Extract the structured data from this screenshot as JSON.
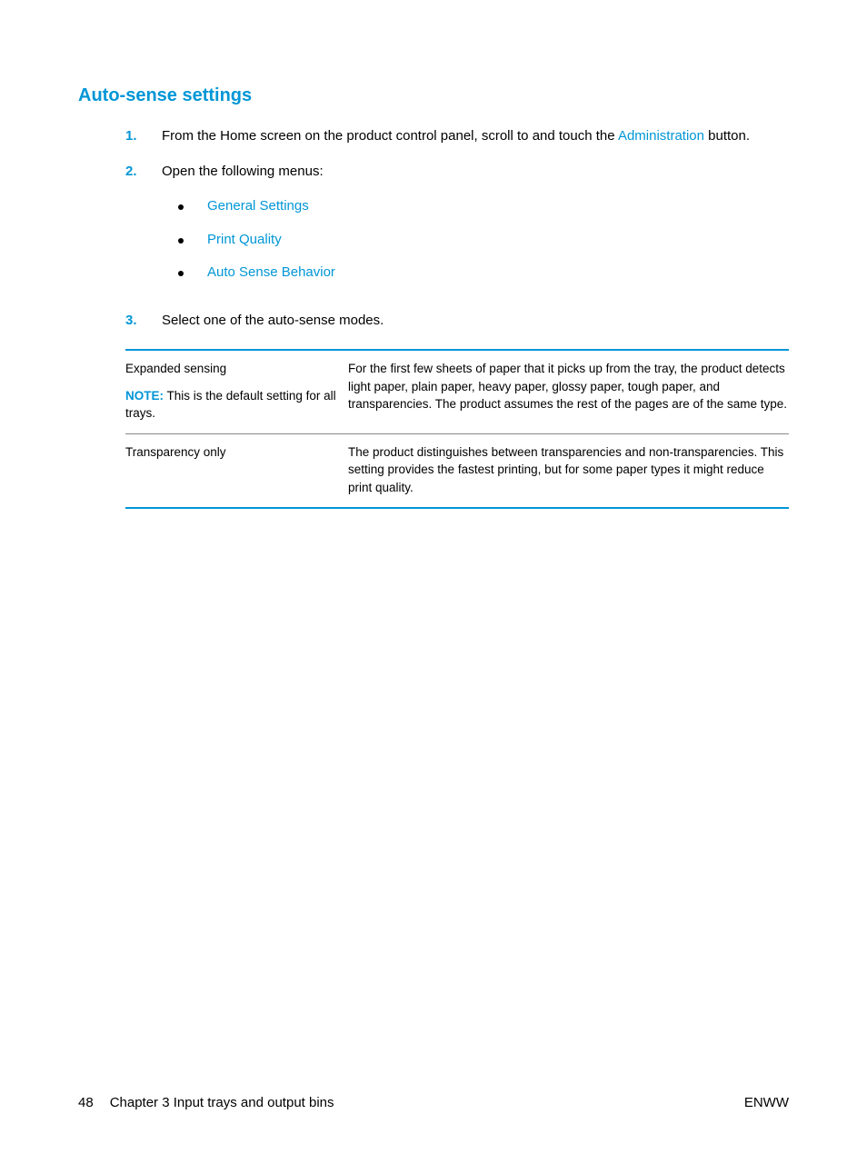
{
  "heading": "Auto-sense settings",
  "steps": [
    {
      "num": "1.",
      "pre": "From the Home screen on the product control panel, scroll to and touch the ",
      "term": "Administration",
      "post": " button."
    },
    {
      "num": "2.",
      "pre": "Open the following menus:",
      "bullets": [
        "General Settings",
        "Print Quality",
        "Auto Sense Behavior"
      ]
    },
    {
      "num": "3.",
      "pre": "Select one of the auto-sense modes."
    }
  ],
  "table": [
    {
      "mode": "Expanded sensing",
      "note_label": "NOTE:",
      "note_text": "This is the default setting for all trays.",
      "desc": "For the first few sheets of paper that it picks up from the tray, the product detects light paper, plain paper, heavy paper, glossy paper, tough paper, and transparencies. The product assumes the rest of the pages are of the same type."
    },
    {
      "mode": "Transparency only",
      "desc": "The product distinguishes between transparencies and non-transparencies. This setting provides the fastest printing, but for some paper types it might reduce print quality."
    }
  ],
  "footer": {
    "page": "48",
    "chapter": "Chapter 3   Input trays and output bins",
    "lang": "ENWW"
  }
}
